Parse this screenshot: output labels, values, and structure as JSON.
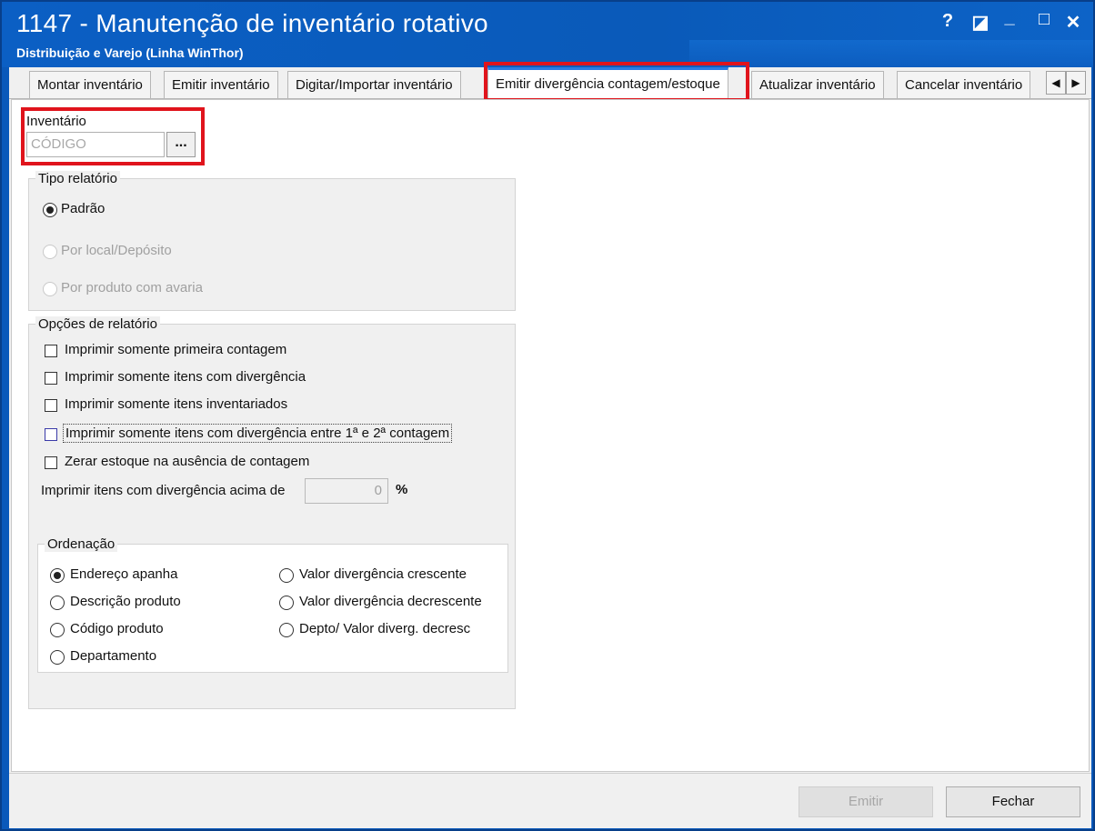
{
  "window": {
    "title": "1147 - Manutenção de inventário rotativo",
    "subtitle": "Distribuição e Varejo (Linha WinThor)",
    "controls": {
      "help": "?",
      "restore": "◪",
      "minimize": "_",
      "maximize": "□",
      "close": "✕"
    }
  },
  "tabs": [
    {
      "label": "Montar inventário"
    },
    {
      "label": "Emitir inventário"
    },
    {
      "label": "Digitar/Importar inventário"
    },
    {
      "label": "Emitir divergência contagem/estoque",
      "active": true
    },
    {
      "label": "Atualizar inventário"
    },
    {
      "label": "Cancelar inventário"
    }
  ],
  "tab_scroll": {
    "left": "◀",
    "right": "▶"
  },
  "inventario": {
    "label": "Inventário",
    "placeholder": "CÓDIGO",
    "value": "",
    "lookup_label": "..."
  },
  "tipo_relatorio": {
    "legend": "Tipo relatório",
    "options": [
      {
        "label": "Padrão",
        "checked": true,
        "enabled": true
      },
      {
        "label": "Por local/Depósito",
        "checked": false,
        "enabled": false
      },
      {
        "label": "Por produto com avaria",
        "checked": false,
        "enabled": false
      }
    ]
  },
  "opcoes_relatorio": {
    "legend": "Opções de relatório",
    "checkboxes": [
      {
        "label": "Imprimir somente primeira contagem",
        "checked": false
      },
      {
        "label": "Imprimir somente itens com divergência",
        "checked": false
      },
      {
        "label": "Imprimir somente itens inventariados",
        "checked": false
      },
      {
        "label": "Imprimir somente itens com divergência entre 1ª e 2ª contagem",
        "checked": false
      },
      {
        "label": "Zerar estoque na ausência de contagem",
        "checked": false
      }
    ],
    "divergencia_label": "Imprimir itens com divergência acima de",
    "divergencia_value": "0",
    "divergencia_unit": "%"
  },
  "ordenacao": {
    "legend": "Ordenação",
    "options": [
      {
        "label": "Endereço apanha",
        "checked": true
      },
      {
        "label": "Descrição produto",
        "checked": false
      },
      {
        "label": "Código produto",
        "checked": false
      },
      {
        "label": "Departamento",
        "checked": false
      },
      {
        "label": "Valor divergência crescente",
        "checked": false
      },
      {
        "label": "Valor divergência decrescente",
        "checked": false
      },
      {
        "label": "Depto/ Valor diverg. decresc",
        "checked": false
      }
    ]
  },
  "footer": {
    "emitir_label": "Emitir",
    "fechar_label": "Fechar"
  },
  "colors": {
    "title_bar": "#0a59ba",
    "highlight": "#e0141c",
    "active_tab_accent": "#2a7be4"
  }
}
